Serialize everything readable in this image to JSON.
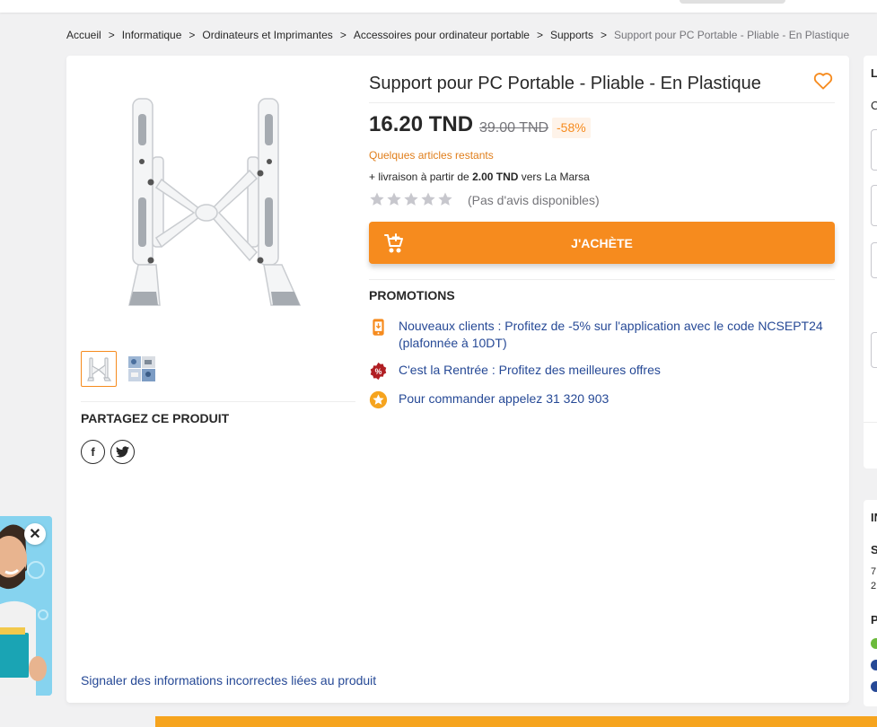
{
  "breadcrumb": {
    "items": [
      "Accueil",
      "Informatique",
      "Ordinateurs et Imprimantes",
      "Accessoires pour ordinateur portable",
      "Supports"
    ],
    "current": "Support pour PC Portable - Pliable - En Plastique"
  },
  "product": {
    "title": "Support pour PC Portable - Pliable - En Plastique",
    "price": "16.20 TND",
    "old_price": "39.00 TND",
    "discount": "-58%",
    "stock_note": "Quelques articles restants",
    "delivery_prefix": "+ livraison à partir de ",
    "delivery_amount": "2.00 TND",
    "delivery_suffix": " vers La Marsa",
    "rating_stars": 0,
    "reviews_text": "(Pas d'avis disponibles)",
    "buy_label": "J'ACHÈTE"
  },
  "promotions": {
    "title": "PROMOTIONS",
    "items": [
      {
        "icon": "app-icon",
        "text": "Nouveaux clients : Profitez de -5% sur l'application avec le code NCSEPT24 (plafonnée à 10DT)"
      },
      {
        "icon": "percent-badge-icon",
        "text": "C'est la Rentrée : Profitez des meilleures offres"
      },
      {
        "icon": "star-badge-icon",
        "text": "Pour commander appelez 31 320 903"
      }
    ]
  },
  "share": {
    "title": "PARTAGEZ CE PRODUIT",
    "networks": [
      "facebook-icon",
      "twitter-icon"
    ]
  },
  "report_link": "Signaler des informations incorrectes liées au produit",
  "right_partial": {
    "top_letters": [
      "L",
      "C"
    ],
    "bottom_letters": [
      "IN",
      "S",
      "7",
      "2",
      "P"
    ]
  },
  "colors": {
    "accent": "#f68b1e",
    "link": "#264996",
    "stock": "#e07e1b"
  }
}
